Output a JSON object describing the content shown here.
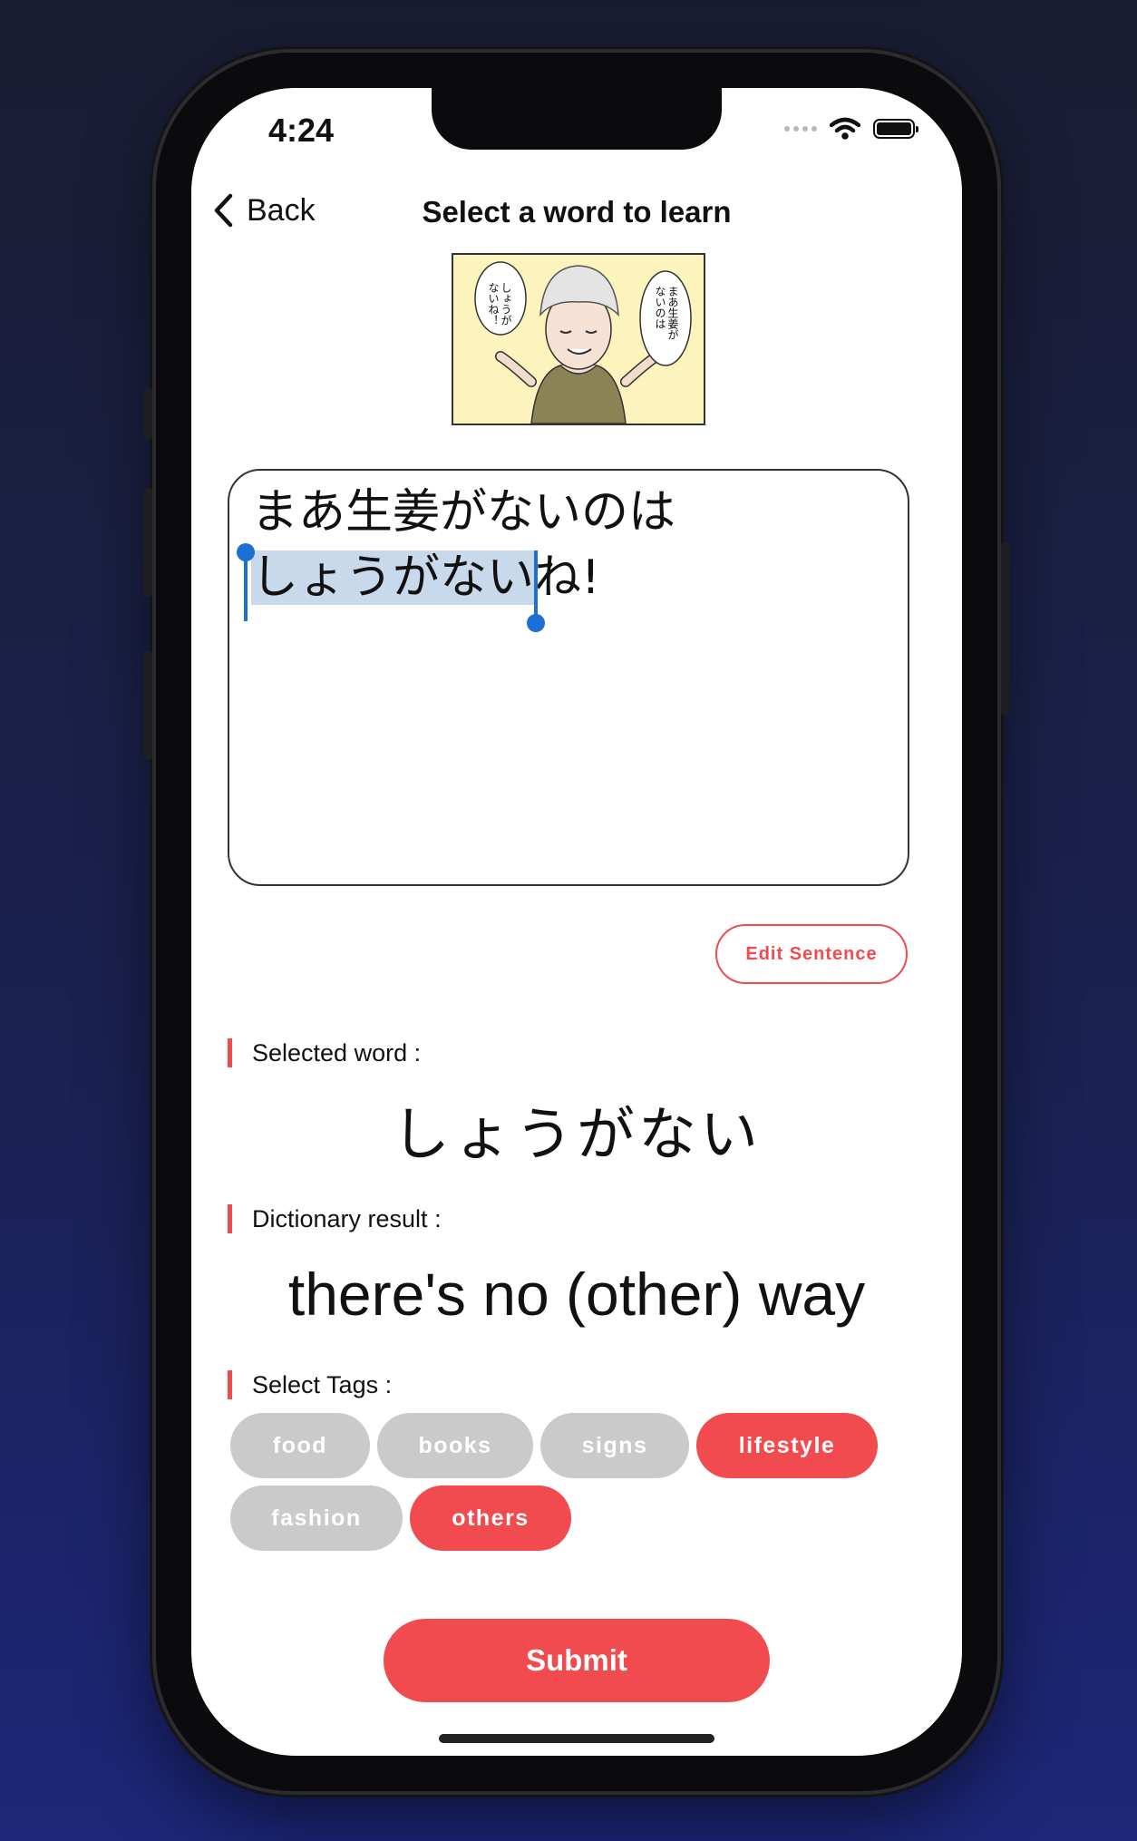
{
  "status_bar": {
    "time": "4:24"
  },
  "nav": {
    "back_label": "Back",
    "title": "Select a word to learn"
  },
  "image": {
    "bubble_left_text": "しょうがないね！",
    "bubble_right_text": "まあ生姜がないのは"
  },
  "sentence": {
    "line1": "まあ生姜がないのは",
    "line2_selected": "しょうがない",
    "line2_rest": "ね!"
  },
  "actions": {
    "edit_sentence_label": "Edit Sentence",
    "submit_label": "Submit"
  },
  "selected_word": {
    "label": "Selected word :",
    "value": "しょうがない"
  },
  "dictionary": {
    "label": "Dictionary result :",
    "value": "there's no (other) way"
  },
  "tags": {
    "label": "Select Tags :",
    "items": [
      {
        "label": "food",
        "selected": false
      },
      {
        "label": "books",
        "selected": false
      },
      {
        "label": "signs",
        "selected": false
      },
      {
        "label": "lifestyle",
        "selected": true
      },
      {
        "label": "fashion",
        "selected": false
      },
      {
        "label": "others",
        "selected": true
      }
    ]
  },
  "colors": {
    "accent": "#f24b4f",
    "tag_inactive": "#cacaca",
    "selection_highlight": "#c7d9ea",
    "selection_handle": "#1d6fd6"
  },
  "icons": {
    "back": "chevron-left-icon",
    "wifi": "wifi-icon",
    "battery": "battery-icon",
    "signal": "cellular-signal-icon"
  }
}
